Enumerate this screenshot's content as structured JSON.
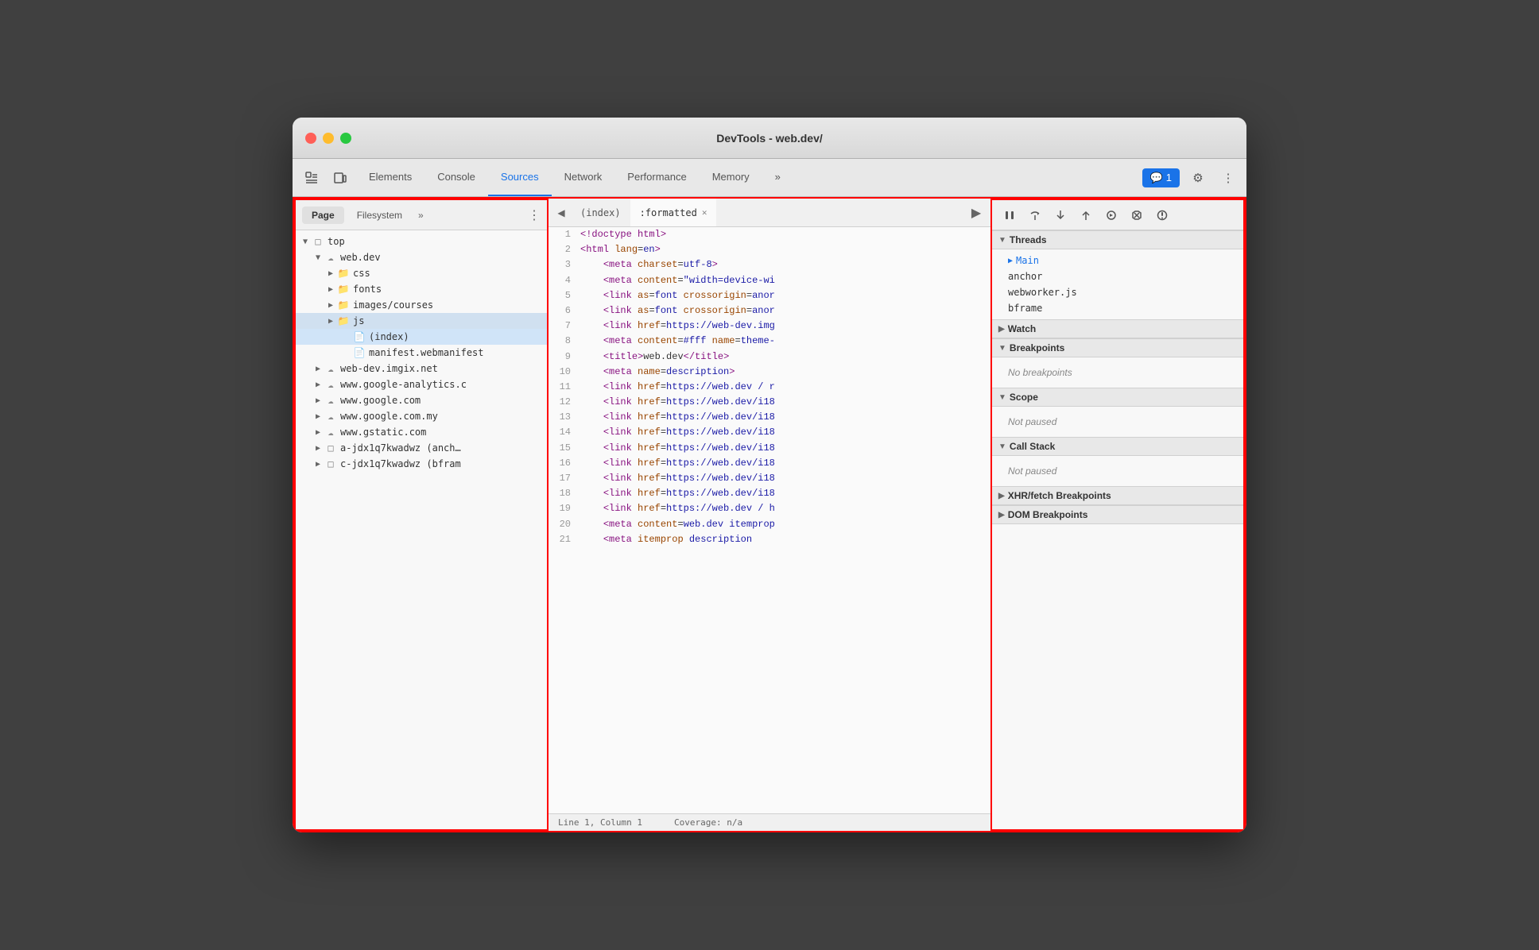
{
  "window": {
    "title": "DevTools - web.dev/"
  },
  "tabs": {
    "items": [
      "Elements",
      "Console",
      "Sources",
      "Network",
      "Performance",
      "Memory"
    ],
    "active": "Sources",
    "more_label": "»",
    "badge_count": "1"
  },
  "left_panel": {
    "tabs": [
      "Page",
      "Filesystem"
    ],
    "active_tab": "Page",
    "more_label": "»",
    "tree": [
      {
        "level": 0,
        "type": "arrow-folder",
        "label": "top",
        "expanded": true
      },
      {
        "level": 1,
        "type": "arrow-cloud",
        "label": "web.dev",
        "expanded": true
      },
      {
        "level": 2,
        "type": "arrow-folder",
        "label": "css",
        "expanded": false,
        "color": "blue"
      },
      {
        "level": 2,
        "type": "arrow-folder",
        "label": "fonts",
        "expanded": false,
        "color": "blue"
      },
      {
        "level": 2,
        "type": "arrow-folder",
        "label": "images/courses",
        "expanded": false,
        "color": "blue"
      },
      {
        "level": 2,
        "type": "arrow-folder",
        "label": "js",
        "expanded": false,
        "color": "blue",
        "selected": true
      },
      {
        "level": 3,
        "type": "file",
        "label": "(index)",
        "selected": true
      },
      {
        "level": 3,
        "type": "file",
        "label": "manifest.webmanifest"
      },
      {
        "level": 1,
        "type": "arrow-cloud",
        "label": "web-dev.imgix.net",
        "expanded": false
      },
      {
        "level": 1,
        "type": "arrow-cloud",
        "label": "www.google-analytics.c",
        "expanded": false
      },
      {
        "level": 1,
        "type": "arrow-cloud",
        "label": "www.google.com",
        "expanded": false
      },
      {
        "level": 1,
        "type": "arrow-cloud",
        "label": "www.google.com.my",
        "expanded": false
      },
      {
        "level": 1,
        "type": "arrow-cloud",
        "label": "www.gstatic.com",
        "expanded": false
      },
      {
        "level": 1,
        "type": "arrow-frame",
        "label": "a-jdx1q7kwadwz (anch…",
        "expanded": false
      },
      {
        "level": 1,
        "type": "arrow-frame",
        "label": "c-jdx1q7kwadwz (bfram",
        "expanded": false
      }
    ]
  },
  "editor": {
    "tabs": [
      {
        "label": "(index)",
        "active": false
      },
      {
        "label": ":formatted",
        "active": true,
        "closeable": true
      }
    ],
    "status": {
      "position": "Line 1, Column 1",
      "coverage": "Coverage: n/a"
    },
    "lines": [
      {
        "num": 1,
        "html": "<span class='tag'>&lt;!doctype html&gt;</span>"
      },
      {
        "num": 2,
        "html": "<span class='tag'>&lt;html</span> <span class='attr-name'>lang</span>=<span class='attr-val'>en</span><span class='tag'>&gt;</span>"
      },
      {
        "num": 3,
        "html": "    <span class='tag'>&lt;meta</span> <span class='attr-name'>charset</span>=<span class='attr-val'>utf-8</span><span class='tag'>&gt;</span>"
      },
      {
        "num": 4,
        "html": "    <span class='tag'>&lt;meta</span> <span class='attr-name'>content</span>=<span class='attr-val'>\"width=device-wi</span>"
      },
      {
        "num": 5,
        "html": "    <span class='tag'>&lt;link</span> <span class='attr-name'>as</span>=<span class='attr-val'>font</span> <span class='attr-name'>crossorigin</span>=<span class='attr-val'>ano</span>"
      },
      {
        "num": 6,
        "html": "    <span class='tag'>&lt;link</span> <span class='attr-name'>as</span>=<span class='attr-val'>font</span> <span class='attr-name'>crossorigin</span>=<span class='attr-val'>ano</span>"
      },
      {
        "num": 7,
        "html": "    <span class='tag'>&lt;link</span> <span class='attr-name'>href</span>=<span class='attr-val'>https://web-dev.img</span>"
      },
      {
        "num": 8,
        "html": "    <span class='tag'>&lt;meta</span> <span class='attr-name'>content</span>=<span class='attr-val'>#fff</span> <span class='attr-name'>name</span>=<span class='attr-val'>theme-</span>"
      },
      {
        "num": 9,
        "html": "    <span class='tag'>&lt;title&gt;</span>web.dev<span class='tag'>&lt;/title&gt;</span>"
      },
      {
        "num": 10,
        "html": "    <span class='tag'>&lt;meta</span> <span class='attr-name'>name</span>=<span class='attr-val'>description</span><span class='tag'>&gt;</span>"
      },
      {
        "num": 11,
        "html": "    <span class='tag'>&lt;link</span> <span class='attr-name'>href</span>=<span class='attr-val'>https://web.dev / r</span>"
      },
      {
        "num": 12,
        "html": "    <span class='tag'>&lt;link</span> <span class='attr-name'>href</span>=<span class='attr-val'>https://web.dev/i18</span>"
      },
      {
        "num": 13,
        "html": "    <span class='tag'>&lt;link</span> <span class='attr-name'>href</span>=<span class='attr-val'>https://web.dev/i18</span>"
      },
      {
        "num": 14,
        "html": "    <span class='tag'>&lt;link</span> <span class='attr-name'>href</span>=<span class='attr-val'>https://web.dev/i18</span>"
      },
      {
        "num": 15,
        "html": "    <span class='tag'>&lt;link</span> <span class='attr-name'>href</span>=<span class='attr-val'>https://web.dev/i18</span>"
      },
      {
        "num": 16,
        "html": "    <span class='tag'>&lt;link</span> <span class='attr-name'>href</span>=<span class='attr-val'>https://web.dev/i18</span>"
      },
      {
        "num": 17,
        "html": "    <span class='tag'>&lt;link</span> <span class='attr-name'>href</span>=<span class='attr-val'>https://web.dev/i18</span>"
      },
      {
        "num": 18,
        "html": "    <span class='tag'>&lt;link</span> <span class='attr-name'>href</span>=<span class='attr-val'>https://web.dev/i18</span>"
      },
      {
        "num": 19,
        "html": "    <span class='tag'>&lt;link</span> <span class='attr-name'>href</span>=<span class='attr-val'>https://web.dev / h</span>"
      },
      {
        "num": 20,
        "html": "    <span class='tag'>&lt;meta</span> <span class='attr-name'>content</span>=<span class='attr-val'>web.dev itemprop</span>"
      },
      {
        "num": 21,
        "html": "    <span class='tag'>&lt;meta</span> <span class='attr-name'>itemprop</span> <span class='attr-val'>description</span>"
      }
    ]
  },
  "right_panel": {
    "debug_buttons": [
      {
        "icon": "⏸",
        "label": "pause",
        "title": "Pause script execution"
      },
      {
        "icon": "↺",
        "label": "step-over",
        "title": "Step over"
      },
      {
        "icon": "↓",
        "label": "step-into",
        "title": "Step into"
      },
      {
        "icon": "↑",
        "label": "step-out",
        "title": "Step out"
      },
      {
        "icon": "⇒",
        "label": "step",
        "title": "Step"
      },
      {
        "icon": "✏",
        "label": "deactivate",
        "title": "Deactivate breakpoints"
      },
      {
        "icon": "⏺",
        "label": "dont-pause",
        "title": "Don't pause on exceptions"
      }
    ],
    "sections": [
      {
        "id": "threads",
        "label": "Threads",
        "expanded": true,
        "items": [
          {
            "label": "Main",
            "active": true
          },
          {
            "label": "anchor",
            "active": false
          },
          {
            "label": "webworker.js",
            "active": false
          },
          {
            "label": "bframe",
            "active": false
          }
        ]
      },
      {
        "id": "watch",
        "label": "Watch",
        "expanded": false,
        "items": []
      },
      {
        "id": "breakpoints",
        "label": "Breakpoints",
        "expanded": true,
        "empty_message": "No breakpoints",
        "items": []
      },
      {
        "id": "scope",
        "label": "Scope",
        "expanded": true,
        "paused_message": "Not paused",
        "items": []
      },
      {
        "id": "call-stack",
        "label": "Call Stack",
        "expanded": true,
        "paused_message": "Not paused",
        "items": []
      },
      {
        "id": "xhr-breakpoints",
        "label": "XHR/fetch Breakpoints",
        "expanded": false,
        "items": []
      },
      {
        "id": "dom-breakpoints",
        "label": "DOM Breakpoints",
        "expanded": false,
        "items": []
      }
    ]
  }
}
